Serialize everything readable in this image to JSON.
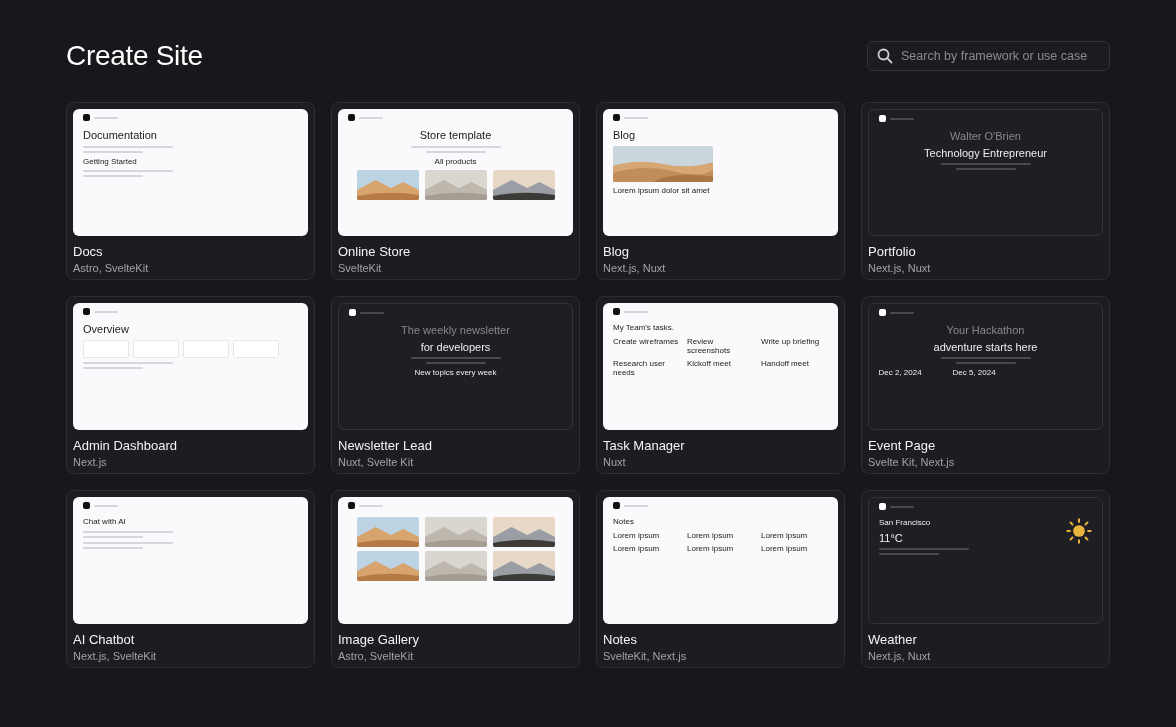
{
  "page": {
    "title": "Create Site"
  },
  "search": {
    "placeholder": "Search by framework or use case"
  },
  "templates": [
    {
      "name": "Docs",
      "frameworks": "Astro, SvelteKit",
      "preview": {
        "dark": false,
        "centered": false,
        "items": [
          {
            "kind": "title",
            "text": "Documentation"
          },
          {
            "kind": "lines"
          },
          {
            "kind": "heading",
            "text": "Getting Started"
          },
          {
            "kind": "lines"
          }
        ]
      }
    },
    {
      "name": "Online Store",
      "frameworks": "SvelteKit",
      "preview": {
        "dark": false,
        "centered": true,
        "items": [
          {
            "kind": "title",
            "text": "Store template"
          },
          {
            "kind": "lines"
          },
          {
            "kind": "heading",
            "text": "All products"
          },
          {
            "kind": "pictures"
          }
        ]
      }
    },
    {
      "name": "Blog",
      "frameworks": "Next.js, Nuxt",
      "preview": {
        "dark": false,
        "centered": false,
        "items": [
          {
            "kind": "title",
            "text": "Blog"
          },
          {
            "kind": "picture"
          },
          {
            "kind": "heading",
            "text": "Lorem ipsum dolor sit amet"
          }
        ]
      }
    },
    {
      "name": "Portfolio",
      "frameworks": "Next.js, Nuxt",
      "preview": {
        "dark": true,
        "centered": true,
        "items": [
          {
            "kind": "subtitle",
            "text": "Walter O'Brien"
          },
          {
            "kind": "title",
            "text": "Technology Entrepreneur"
          },
          {
            "kind": "lines"
          }
        ]
      }
    },
    {
      "name": "Admin Dashboard",
      "frameworks": "Next.js",
      "preview": {
        "dark": false,
        "centered": false,
        "items": [
          {
            "kind": "title",
            "text": "Overview"
          },
          {
            "kind": "stats"
          },
          {
            "kind": "lines"
          }
        ]
      }
    },
    {
      "name": "Newsletter Lead",
      "frameworks": "Nuxt, Svelte Kit",
      "preview": {
        "dark": true,
        "centered": true,
        "items": [
          {
            "kind": "subtitle",
            "text": "The weekly newsletter"
          },
          {
            "kind": "title",
            "text": "for developers"
          },
          {
            "kind": "lines"
          },
          {
            "kind": "heading",
            "text": "New topics every week"
          }
        ]
      }
    },
    {
      "name": "Task Manager",
      "frameworks": "Nuxt",
      "preview": {
        "dark": false,
        "centered": false,
        "items": [
          {
            "kind": "heading",
            "text": "My Team's tasks."
          },
          {
            "kind": "columns",
            "cells": [
              "Create wireframes",
              "Review screenshots",
              "Write up briefing",
              "Research user needs",
              "Kickoff meet",
              "Handoff meet"
            ]
          }
        ]
      }
    },
    {
      "name": "Event Page",
      "frameworks": "Svelte Kit, Next.js",
      "preview": {
        "dark": true,
        "centered": true,
        "items": [
          {
            "kind": "subtitle",
            "text": "Your Hackathon"
          },
          {
            "kind": "title",
            "text": "adventure starts here"
          },
          {
            "kind": "lines"
          },
          {
            "kind": "columns",
            "cells": [
              "Dec 2, 2024",
              "Dec 5, 2024"
            ]
          }
        ]
      }
    },
    {
      "name": "AI Chatbot",
      "frameworks": "Next.js, SvelteKit",
      "preview": {
        "dark": false,
        "centered": false,
        "items": [
          {
            "kind": "heading",
            "text": "Chat with AI"
          },
          {
            "kind": "lines"
          },
          {
            "kind": "lines"
          }
        ]
      }
    },
    {
      "name": "Image Gallery",
      "frameworks": "Astro, SvelteKit",
      "preview": {
        "dark": false,
        "centered": true,
        "items": [
          {
            "kind": "pictures"
          },
          {
            "kind": "pictures"
          }
        ]
      }
    },
    {
      "name": "Notes",
      "frameworks": "SvelteKit, Next.js",
      "preview": {
        "dark": false,
        "centered": false,
        "items": [
          {
            "kind": "heading",
            "text": "Notes"
          },
          {
            "kind": "columns",
            "cells": [
              "Lorem ipsum",
              "Lorem ipsum",
              "Lorem ipsum",
              "Lorem ipsum",
              "Lorem ipsum",
              "Lorem ipsum"
            ]
          }
        ]
      }
    },
    {
      "name": "Weather",
      "frameworks": "Next.js, Nuxt",
      "preview": {
        "dark": true,
        "centered": false,
        "items": [
          {
            "kind": "heading",
            "text": "San Francisco"
          },
          {
            "kind": "title",
            "text": "11°C"
          },
          {
            "kind": "sun"
          },
          {
            "kind": "lines"
          }
        ]
      }
    }
  ]
}
